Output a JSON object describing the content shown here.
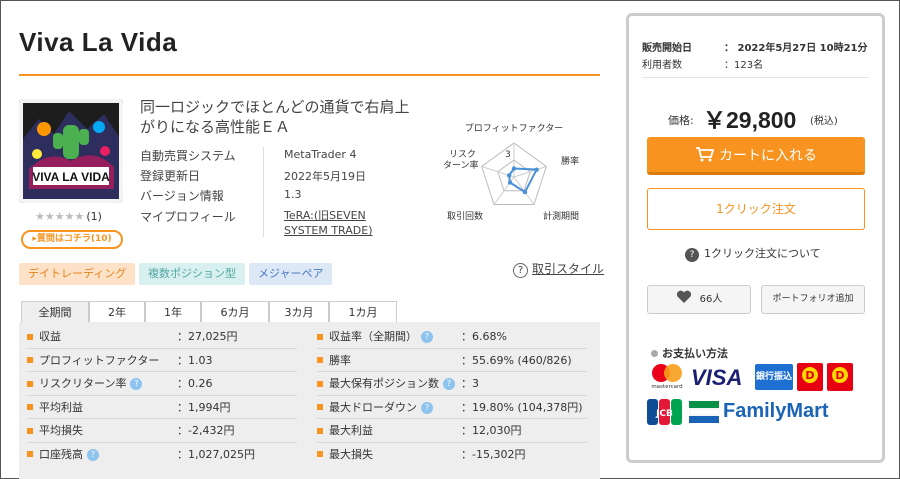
{
  "product": {
    "title": "Viva La Vida",
    "thumb_text": "VIVA LA VIDA",
    "rating_stars": "★★★★★",
    "rating_count": "(1)",
    "qa_button": "▸質問はコチラ(10)",
    "description": "同一ロジックでほとんどの通貨で右肩上がりになる高性能ＥＡ"
  },
  "info": [
    {
      "label": "自動売買システム",
      "value": "MetaTrader 4"
    },
    {
      "label": "登録更新日",
      "value": "2022年5月19日"
    },
    {
      "label": "バージョン情報",
      "value": "1.3"
    },
    {
      "label": "マイプロフィール",
      "value": "TeRA:(旧SEVEN SYSTEM TRADE)"
    }
  ],
  "radar": {
    "labels": [
      "プロフィットファクター",
      "勝率",
      "計測期間",
      "取引回数",
      "リスクターン率"
    ],
    "label_risk_line1": "リスク",
    "label_risk_line2": "ターン率",
    "center_value": "3",
    "values": [
      0.25,
      0.7,
      0.55,
      0.2,
      0.15
    ]
  },
  "tags": [
    "デイトレーディング",
    "複数ポジション型",
    "メジャーペア"
  ],
  "trade_style": {
    "icon": "?",
    "label": "取引スタイル"
  },
  "tabs": [
    "全期間",
    "2年",
    "1年",
    "6カ月",
    "3カ月",
    "1カ月"
  ],
  "stats_left": [
    {
      "label": "収益",
      "value": "27,025円",
      "help": false
    },
    {
      "label": "プロフィットファクター",
      "value": "1.03",
      "help": false
    },
    {
      "label": "リスクリターン率",
      "value": "0.26",
      "help": true
    },
    {
      "label": "平均利益",
      "value": "1,994円",
      "help": false
    },
    {
      "label": "平均損失",
      "value": "-2,432円",
      "help": false
    },
    {
      "label": "口座残高",
      "value": "1,027,025円",
      "help": true
    }
  ],
  "stats_right": [
    {
      "label": "収益率（全期間）",
      "value": "6.68%",
      "help": true
    },
    {
      "label": "勝率",
      "value": "55.69% (460/826)",
      "help": false
    },
    {
      "label": "最大保有ポジション数",
      "value": "3",
      "help": true
    },
    {
      "label": "最大ドローダウン",
      "value": "19.80% (104,378円)",
      "help": true
    },
    {
      "label": "最大利益",
      "value": "12,030円",
      "help": false
    },
    {
      "label": "最大損失",
      "value": "-15,302円",
      "help": false
    }
  ],
  "sidebar": {
    "sale_start_label": "販売開始日",
    "sale_start_value": "2022年5月27日 10時21分",
    "users_label": "利用者数",
    "users_value": "123名",
    "colon": "：",
    "price_label": "価格:",
    "price": "￥29,800",
    "price_tax": "(税込)",
    "cart_button": "カートに入れる",
    "oneclick_button": "1クリック注文",
    "about_oneclick": "1クリック注文について",
    "about_icon": "?",
    "fav_count": "66人",
    "portfolio_button": "ポートフォリオ追加",
    "payment_title": "お支払い方法",
    "payments": {
      "mastercard": "mastercard",
      "visa": "VISA",
      "bank": "銀行振込",
      "jcb": "JCB",
      "familymart": "FamilyMart"
    }
  },
  "colors": {
    "accent": "#f7931e",
    "radar": "#4a90d9"
  }
}
